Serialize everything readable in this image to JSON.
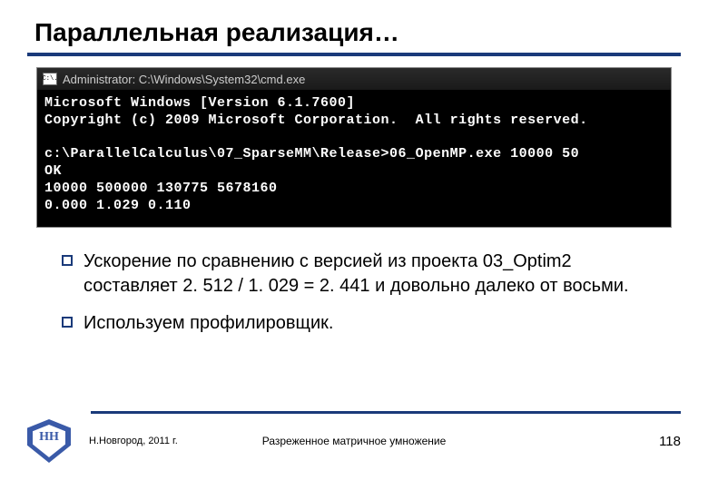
{
  "title": "Параллельная реализация…",
  "cmd": {
    "icon_text": "C:\\.",
    "titlebar": "Administrator: C:\\Windows\\System32\\cmd.exe",
    "lines": [
      "Microsoft Windows [Version 6.1.7600]",
      "Copyright (c) 2009 Microsoft Corporation.  All rights reserved.",
      "",
      "c:\\ParallelCalculus\\07_SparseMM\\Release>06_OpenMP.exe 10000 50",
      "OK",
      "10000 500000 130775 5678160",
      "0.000 1.029 0.110"
    ]
  },
  "bullets": [
    "Ускорение по сравнению с версией из проекта 03_Optim2 составляет 2. 512 / 1. 029 = 2. 441 и довольно далеко от восьми.",
    "Используем профилировщик."
  ],
  "footer": {
    "logo_text": "НН",
    "location": "Н.Новгород, 2011 г.",
    "center": "Разреженное матричное умножение",
    "page": "118"
  }
}
